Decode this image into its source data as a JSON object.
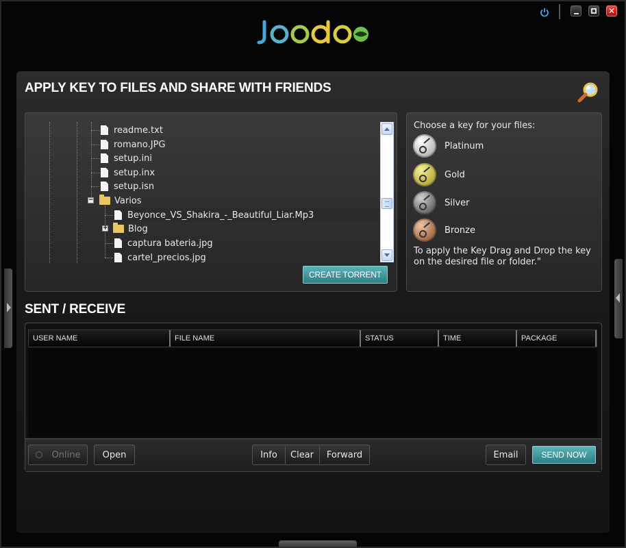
{
  "app": {
    "logo_text": "Joodoo",
    "colors": {
      "accent_teal": "#3a9aa0",
      "logo_blue": "#4aa6d8",
      "logo_yellow": "#e8d04a",
      "logo_green": "#6bc24a",
      "close_red": "#cc2222"
    }
  },
  "window_controls": {
    "power": "power-icon",
    "minimize": "minimize-icon",
    "maximize": "maximize-icon",
    "close": "close-icon",
    "close_glyph": "✕"
  },
  "apply_section": {
    "heading": "APPLY KEY TO FILES AND SHARE WITH FRIENDS",
    "file_tree": [
      {
        "name": "readme.txt",
        "type": "file",
        "level": 2
      },
      {
        "name": "romano.JPG",
        "type": "file",
        "level": 2
      },
      {
        "name": "setup.ini",
        "type": "file",
        "level": 2
      },
      {
        "name": "setup.inx",
        "type": "file",
        "level": 2
      },
      {
        "name": "setup.isn",
        "type": "file",
        "level": 2
      },
      {
        "name": "Varios",
        "type": "folder",
        "level": 2,
        "expanded": true
      },
      {
        "name": "Beyonce_VS_Shakira_-_Beautiful_Liar.Mp3",
        "type": "file",
        "level": 3,
        "selected": true
      },
      {
        "name": "Blog",
        "type": "folder",
        "level": 3,
        "expanded": false
      },
      {
        "name": "captura bateria.jpg",
        "type": "file",
        "level": 3
      },
      {
        "name": "cartel_precios.jpg",
        "type": "file",
        "level": 3
      }
    ],
    "create_torrent_label": "CREATE TORRENT"
  },
  "keys": {
    "title": "Choose a key for your files:",
    "options": [
      {
        "label": "Platinum",
        "color": "#d8d8d8"
      },
      {
        "label": "Gold",
        "color": "#d8cf6a"
      },
      {
        "label": "Silver",
        "color": "#9a9a9a"
      },
      {
        "label": "Bronze",
        "color": "#c99270"
      }
    ],
    "help": "To apply the Key Drag and Drop the key on the desired file or folder.\""
  },
  "sent_receive": {
    "heading": "SENT / RECEIVE",
    "columns": [
      "USER NAME",
      "FILE NAME",
      "STATUS",
      "TIME",
      "PACKAGE"
    ],
    "rows": []
  },
  "toolbar": {
    "online_label": "Online",
    "open_label": "Open",
    "info_label": "Info",
    "clear_label": "Clear",
    "forward_label": "Forward",
    "email_label": "Email",
    "send_now_label": "SEND NOW"
  }
}
